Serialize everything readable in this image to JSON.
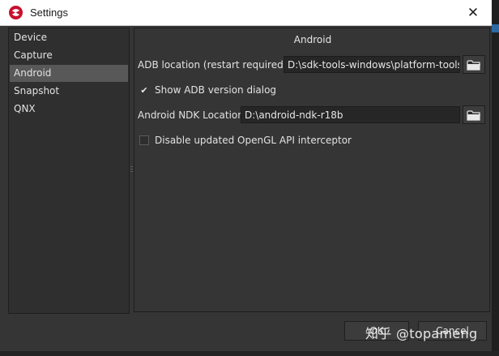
{
  "window": {
    "title": "Settings",
    "close_glyph": "✕"
  },
  "sidebar": {
    "items": [
      {
        "label": "Device"
      },
      {
        "label": "Capture"
      },
      {
        "label": "Android",
        "selected": true
      },
      {
        "label": "Snapshot"
      },
      {
        "label": "QNX"
      }
    ]
  },
  "android": {
    "section_title": "Android",
    "adb_label": "ADB location (restart required)",
    "adb_value": "D:\\sdk-tools-windows\\platform-tools",
    "show_adb_dialog_label": "Show ADB version dialog",
    "show_adb_dialog_checked": true,
    "ndk_label": "Android NDK Location",
    "ndk_value": "D:\\android-ndk-r18b",
    "disable_opengl_label": "Disable updated OpenGL API interceptor",
    "disable_opengl_checked": false
  },
  "buttons": {
    "ok": "OK",
    "cancel": "Cancel"
  },
  "watermark": {
    "text": "知乎 @topameng"
  },
  "icons": {
    "app": "snapdragon-logo-icon",
    "browse": "folder-icon",
    "check": "checkmark-icon"
  },
  "colors": {
    "brand": "#c8102e",
    "selected": "#585858"
  }
}
